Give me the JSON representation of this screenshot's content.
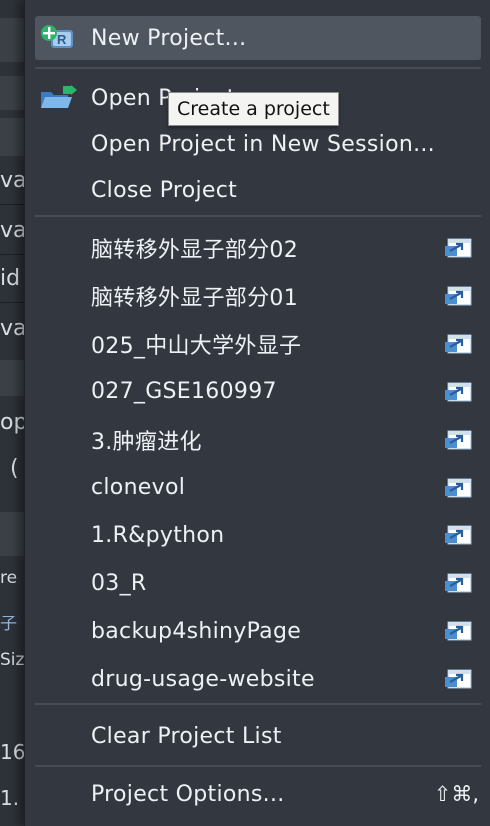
{
  "background": {
    "fragments": [
      "va",
      "va",
      "id",
      "va",
      "op",
      "(",
      "re",
      "子",
      "Siz",
      "16",
      "1."
    ]
  },
  "menu": {
    "new_project": "New Project...",
    "open_project": "Open Project...",
    "open_project_new_session": "Open Project in New Session...",
    "close_project": "Close Project",
    "recent_projects": [
      "脑转移外显子部分02",
      "脑转移外显子部分01",
      "025_中山大学外显子",
      "027_GSE160997",
      "3.肿瘤进化",
      "clonevol",
      "1.R&python",
      "03_R",
      "backup4shinyPage",
      "drug-usage-website"
    ],
    "clear_project_list": "Clear Project List",
    "project_options": "Project Options...",
    "project_options_shortcut": "⇧⌘,"
  },
  "tooltip": {
    "text": "Create a project"
  },
  "colors": {
    "menu_bg": "#333840",
    "highlight": "#505660",
    "text": "#eef1f4",
    "separator": "#464c55",
    "accent_green": "#2db36a",
    "icon_blue": "#7fb8e8"
  },
  "icons": {
    "new_project": "new-project-icon",
    "open_project": "open-folder-icon",
    "recent_item": "open-in-new-session-icon"
  }
}
